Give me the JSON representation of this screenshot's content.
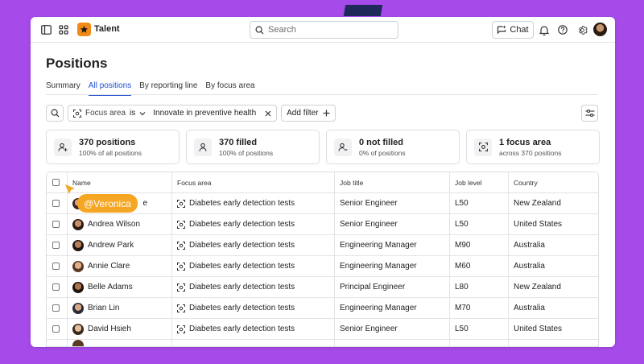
{
  "app": {
    "name": "Talent"
  },
  "search": {
    "placeholder": "Search"
  },
  "header": {
    "chat_label": "Chat"
  },
  "page": {
    "title": "Positions"
  },
  "tabs": [
    {
      "label": "Summary"
    },
    {
      "label": "All positions"
    },
    {
      "label": "By reporting line"
    },
    {
      "label": "By focus area"
    }
  ],
  "filter": {
    "field": "Focus area",
    "operator": "is",
    "value": "Innovate in preventive health",
    "add_label": "Add filter"
  },
  "cards": [
    {
      "title": "370 positions",
      "sub": "100% of all positions"
    },
    {
      "title": "370 filled",
      "sub": "100% of positions"
    },
    {
      "title": "0 not filled",
      "sub": "0% of positions"
    },
    {
      "title": "1 focus area",
      "sub": "across 370 positions"
    }
  ],
  "table": {
    "headers": [
      "Name",
      "Focus area",
      "Job title",
      "Job level",
      "Country"
    ],
    "rows": [
      {
        "name": "",
        "name_tail": "e",
        "focus": "Diabetes early detection tests",
        "job": "Senior Engineer",
        "level": "L50",
        "country": "New Zealand"
      },
      {
        "name": "Andrea Wilson",
        "name_tail": "",
        "focus": "Diabetes early detection tests",
        "job": "Senior Engineer",
        "level": "L50",
        "country": "United States"
      },
      {
        "name": "Andrew Park",
        "name_tail": "",
        "focus": "Diabetes early detection tests",
        "job": "Engineering Manager",
        "level": "M90",
        "country": "Australia"
      },
      {
        "name": "Annie Clare",
        "name_tail": "",
        "focus": "Diabetes early detection tests",
        "job": "Engineering Manager",
        "level": "M60",
        "country": "Australia"
      },
      {
        "name": "Belle Adams",
        "name_tail": "",
        "focus": "Diabetes early detection tests",
        "job": "Principal Engineer",
        "level": "L80",
        "country": "New Zealand"
      },
      {
        "name": "Brian Lin",
        "name_tail": "",
        "focus": "Diabetes early detection tests",
        "job": "Engineering Manager",
        "level": "M70",
        "country": "Australia"
      },
      {
        "name": "David Hsieh",
        "name_tail": "",
        "focus": "Diabetes early detection tests",
        "job": "Senior Engineer",
        "level": "L50",
        "country": "United States"
      }
    ]
  },
  "cursor": {
    "label": "@Veronica",
    "color": "#f5a623"
  },
  "colors": {
    "accent": "#1f4fd1",
    "brand": "#f28a18",
    "frame": "#a64bea"
  },
  "icons": [
    "sidebar-toggle-icon",
    "grid-icon",
    "star-icon",
    "search-icon",
    "chat-sparkle-icon",
    "bell-icon",
    "help-icon",
    "gear-icon",
    "filter-focus-icon",
    "chevron-down-icon",
    "close-icon",
    "plus-icon",
    "sliders-icon",
    "user-plus-icon",
    "user-icon",
    "user-minus-icon",
    "focus-area-icon"
  ]
}
